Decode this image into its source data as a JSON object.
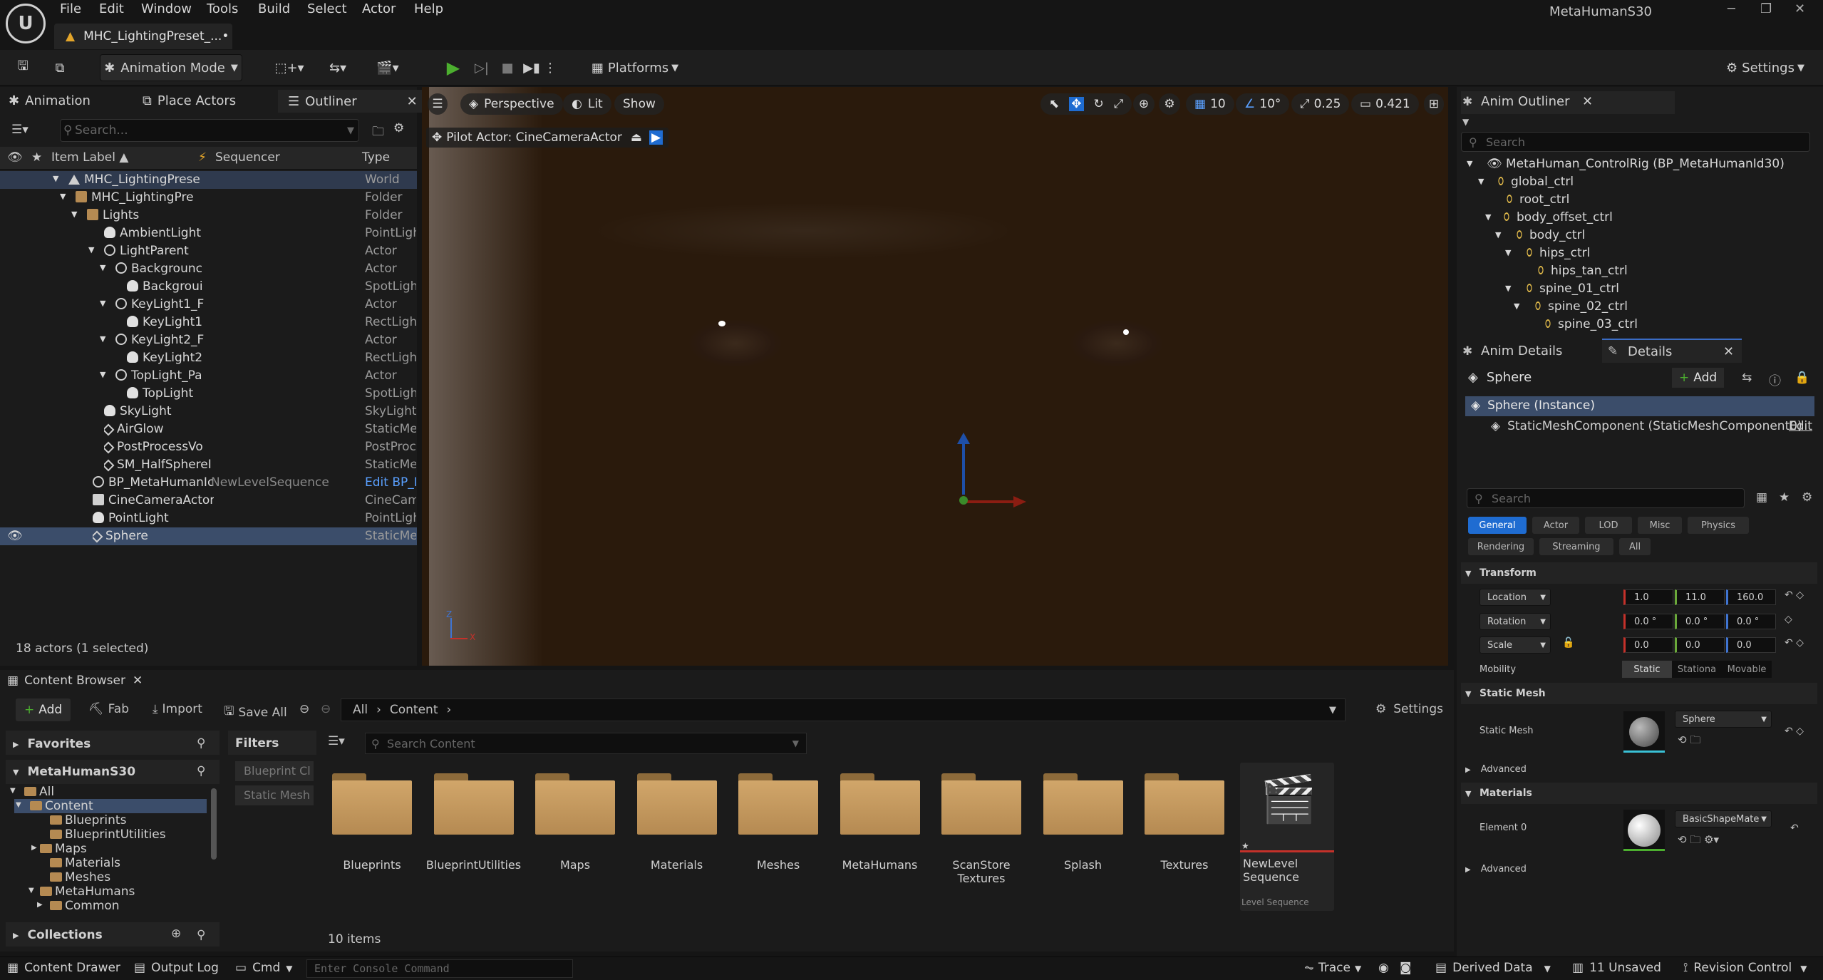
{
  "app": {
    "project_name": "MetaHumanS30",
    "doc_tab": "MHC_LightingPreset_...•",
    "logo_text": "U"
  },
  "menu": [
    "File",
    "Edit",
    "Window",
    "Tools",
    "Build",
    "Select",
    "Actor",
    "Help"
  ],
  "toolbar": {
    "mode": "Animation Mode",
    "platforms": "Platforms",
    "settings": "Settings"
  },
  "left_tabs": {
    "animation": "Animation",
    "place_actors": "Place Actors",
    "outliner": "Outliner"
  },
  "outliner": {
    "search_placeholder": "Search...",
    "col_label": "Item Label ▲",
    "col_sequencer": "Sequencer",
    "col_type": "Type",
    "rows": [
      {
        "label": "MHC_LightingPrese",
        "type": "World"
      },
      {
        "label": "MHC_LightingPre",
        "type": "Folder"
      },
      {
        "label": "Lights",
        "type": "Folder"
      },
      {
        "label": "AmbientLight",
        "type": "PointLigh"
      },
      {
        "label": "LightParent",
        "type": "Actor"
      },
      {
        "label": "Backgrounc",
        "type": "Actor"
      },
      {
        "label": "Backgroui",
        "type": "SpotLight"
      },
      {
        "label": "KeyLight1_F",
        "type": "Actor"
      },
      {
        "label": "KeyLight1",
        "type": "RectLight"
      },
      {
        "label": "KeyLight2_F",
        "type": "Actor"
      },
      {
        "label": "KeyLight2",
        "type": "RectLight"
      },
      {
        "label": "TopLight_Pa",
        "type": "Actor"
      },
      {
        "label": "TopLight",
        "type": "SpotLight"
      },
      {
        "label": "SkyLight",
        "type": "SkyLight"
      },
      {
        "label": "AirGlow",
        "type": "StaticMes"
      },
      {
        "label": "PostProcessVo",
        "type": "PostProc"
      },
      {
        "label": "SM_HalfSphereI",
        "type": "StaticMes"
      },
      {
        "label": "BP_MetaHumanIc",
        "seq": "NewLevelSequence",
        "type": "Edit BP_M"
      },
      {
        "label": "CineCameraActor",
        "type": "CineCam"
      },
      {
        "label": "PointLight",
        "type": "PointLigh"
      },
      {
        "label": "Sphere",
        "type": "StaticMes"
      }
    ],
    "status": "18 actors (1 selected)"
  },
  "viewport": {
    "perspective": "Perspective",
    "lit": "Lit",
    "show": "Show",
    "pilot": "Pilot Actor: CineCameraActor",
    "grid": "10",
    "angle": "10°",
    "scale": "0.25",
    "cam_speed": "0.421"
  },
  "anim_outliner": {
    "title": "Anim Outliner",
    "search": "Search",
    "rows": [
      "MetaHuman_ControlRig (BP_MetaHumanId30)",
      "global_ctrl",
      "root_ctrl",
      "body_offset_ctrl",
      "body_ctrl",
      "hips_ctrl",
      "hips_tan_ctrl",
      "spine_01_ctrl",
      "spine_02_ctrl",
      "spine_03_ctrl"
    ]
  },
  "details": {
    "tab_anim": "Anim Details",
    "tab_details": "Details",
    "object": "Sphere",
    "add": "Add",
    "instance": "Sphere (Instance)",
    "component": "StaticMeshComponent (StaticMeshComponent0)",
    "edit": "Edit",
    "search": "Search",
    "categories": [
      "General",
      "Actor",
      "LOD",
      "Misc",
      "Physics",
      "Rendering",
      "Streaming",
      "All"
    ],
    "transform": "Transform",
    "location": "Location",
    "rotation": "Rotation",
    "scale": "Scale",
    "loc": [
      "1.0",
      "11.0",
      "160.0"
    ],
    "rot": [
      "0.0 °",
      "0.0 °",
      "0.0 °"
    ],
    "scl": [
      "0.0",
      "0.0",
      "0.0"
    ],
    "mobility": "Mobility",
    "mob_opts": [
      "Static",
      "Stationa",
      "Movable"
    ],
    "static_mesh_hdr": "Static Mesh",
    "static_mesh_lbl": "Static Mesh",
    "static_mesh_val": "Sphere",
    "advanced": "Advanced",
    "materials_hdr": "Materials",
    "element0": "Element 0",
    "material_val": "BasicShapeMate",
    "advanced2": "Advanced"
  },
  "content_browser": {
    "title": "Content Browser",
    "add": "Add",
    "fab": "Fab",
    "import": "Import",
    "save_all": "Save All",
    "path_all": "All",
    "path_content": "Content",
    "settings": "Settings",
    "favorites": "Favorites",
    "project": "MetaHumanS30",
    "filters": "Filters",
    "filter_chips": [
      "Blueprint Cl",
      "Static Mesh"
    ],
    "search": "Search Content",
    "tree": [
      "All",
      "Content",
      "Blueprints",
      "BlueprintUtilities",
      "Maps",
      "Materials",
      "Meshes",
      "MetaHumans",
      "Common"
    ],
    "collections": "Collections",
    "folders": [
      "Blueprints",
      "BlueprintUtilities",
      "Maps",
      "Materials",
      "Meshes",
      "MetaHumans",
      "ScanStore Textures",
      "Splash",
      "Textures"
    ],
    "asset": {
      "name": "NewLevel Sequence",
      "type": "Level Sequence"
    },
    "count": "10 items"
  },
  "statusbar": {
    "content_drawer": "Content Drawer",
    "output_log": "Output Log",
    "cmd": "Cmd",
    "console_placeholder": "Enter Console Command",
    "trace": "Trace",
    "derived": "Derived Data",
    "unsaved": "11 Unsaved",
    "revision": "Revision Control"
  }
}
